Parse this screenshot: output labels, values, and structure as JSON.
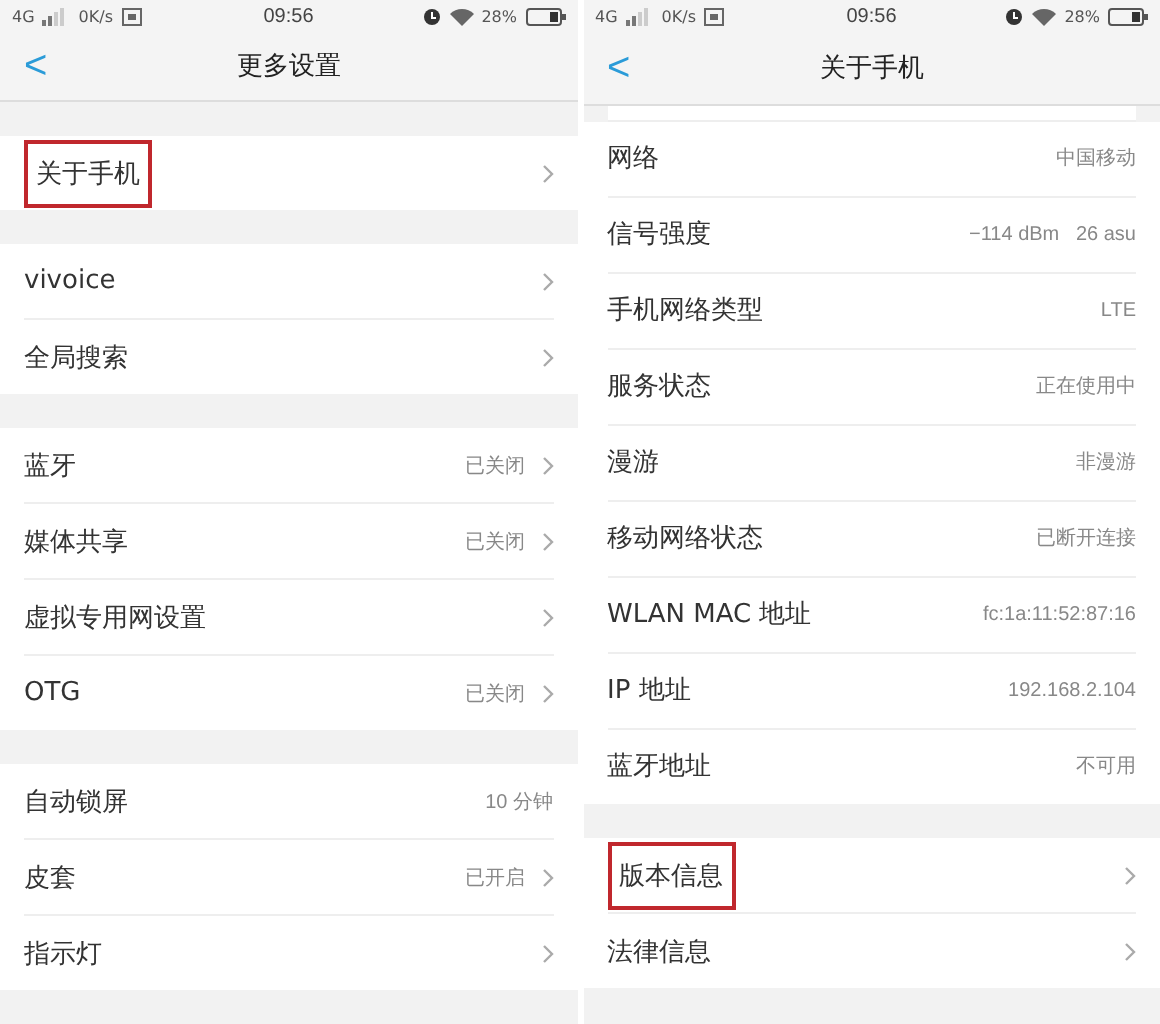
{
  "panels": [
    {
      "status_bar": {
        "network": "4G",
        "speed": "0K/s",
        "time": "09:56",
        "battery": "28%"
      },
      "title": "更多设置",
      "back": "<",
      "groups": [
        {
          "rows": [
            {
              "label": "关于手机",
              "chevron": true,
              "highlighted": true
            }
          ]
        },
        {
          "rows": [
            {
              "label": "vivoice",
              "chevron": true,
              "highlighted": false
            },
            {
              "label": "全局搜索",
              "chevron": true,
              "highlighted": false
            }
          ]
        },
        {
          "rows": [
            {
              "label": "蓝牙",
              "value": "已关闭",
              "chevron": true,
              "highlighted": false
            },
            {
              "label": "媒体共享",
              "value": "已关闭",
              "chevron": true,
              "highlighted": false
            },
            {
              "label": "虚拟专用网设置",
              "chevron": true,
              "highlighted": false
            },
            {
              "label": "OTG",
              "value": "已关闭",
              "chevron": true,
              "highlighted": false
            }
          ]
        },
        {
          "rows": [
            {
              "label": "自动锁屏",
              "value": "10 分钟",
              "chevron": false,
              "highlighted": false
            },
            {
              "label": "皮套",
              "value": "已开启",
              "chevron": true,
              "highlighted": false
            },
            {
              "label": "指示灯",
              "chevron": true,
              "highlighted": false
            }
          ]
        }
      ]
    },
    {
      "status_bar": {
        "network": "4G",
        "speed": "0K/s",
        "time": "09:56",
        "battery": "28%"
      },
      "title": "关于手机",
      "back": "<",
      "clipped_top": true,
      "groups": [
        {
          "rows": [
            {
              "label": "网络",
              "value": "中国移动",
              "chevron": false,
              "highlighted": false
            },
            {
              "label": "信号强度",
              "value": "−114 dBm   26 asu",
              "chevron": false,
              "highlighted": false
            },
            {
              "label": "手机网络类型",
              "value": "LTE",
              "chevron": false,
              "highlighted": false
            },
            {
              "label": "服务状态",
              "value": "正在使用中",
              "chevron": false,
              "highlighted": false
            },
            {
              "label": "漫游",
              "value": "非漫游",
              "chevron": false,
              "highlighted": false
            },
            {
              "label": "移动网络状态",
              "value": "已断开连接",
              "chevron": false,
              "highlighted": false
            },
            {
              "label": "WLAN MAC 地址",
              "value": "fc:1a:11:52:87:16",
              "chevron": false,
              "highlighted": false
            },
            {
              "label": "IP 地址",
              "value": "192.168.2.104",
              "chevron": false,
              "highlighted": false
            },
            {
              "label": "蓝牙地址",
              "value": "不可用",
              "chevron": false,
              "highlighted": false
            }
          ]
        },
        {
          "rows": [
            {
              "label": "版本信息",
              "chevron": true,
              "highlighted": true
            },
            {
              "label": "法律信息",
              "chevron": true,
              "highlighted": false
            }
          ]
        }
      ]
    }
  ]
}
